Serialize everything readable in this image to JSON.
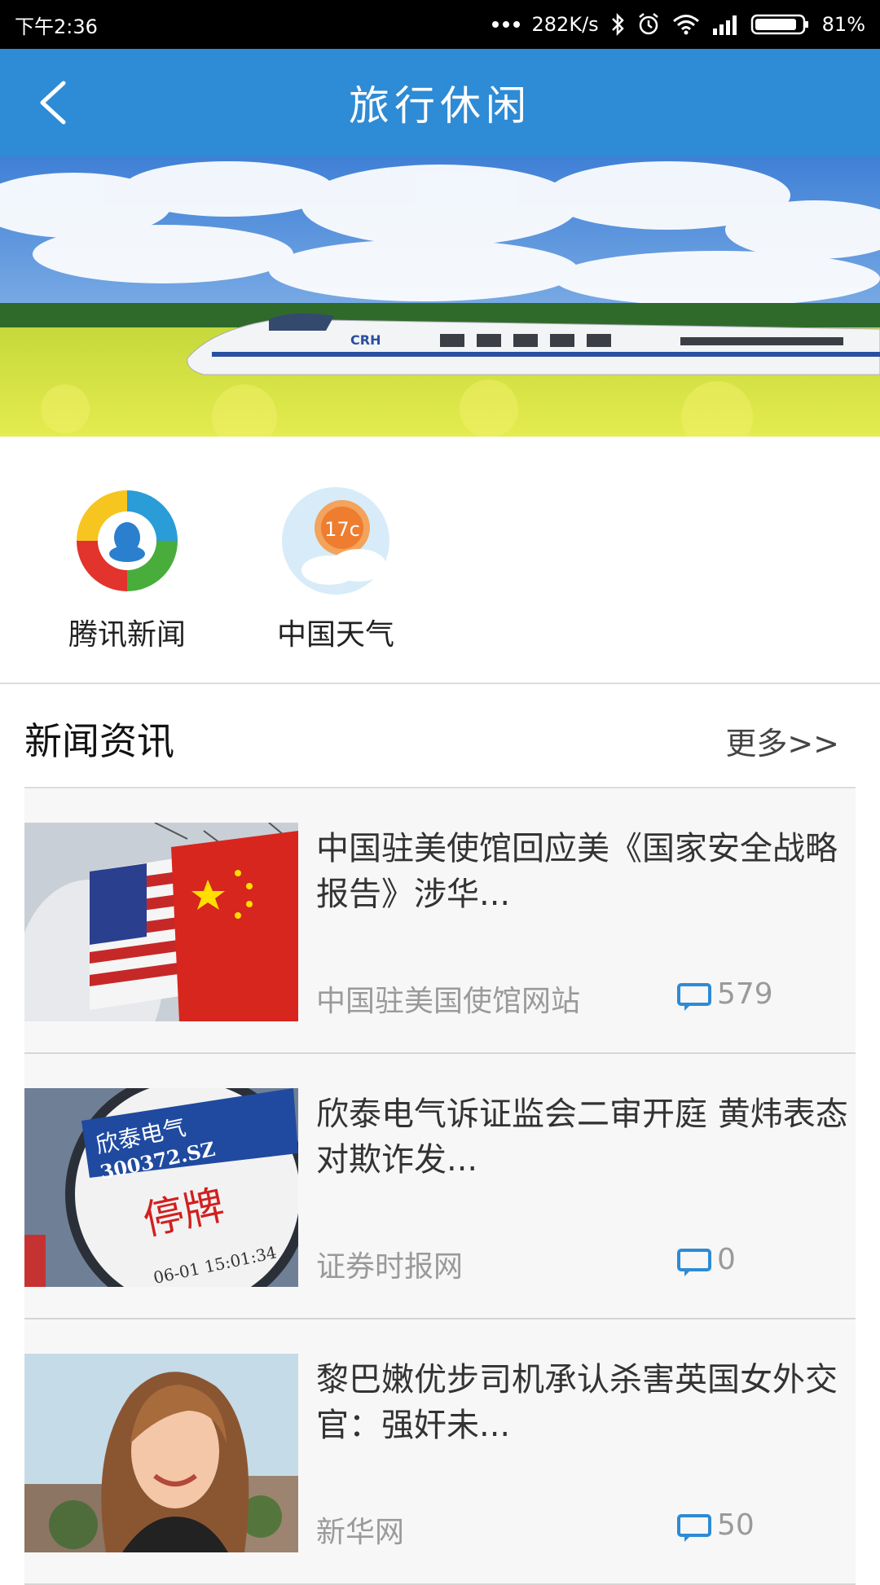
{
  "status_bar": {
    "time": "下午2:36",
    "network_speed": "282K/s",
    "battery": "81%"
  },
  "header": {
    "title": "旅行休闲",
    "back_icon": "chevron-left-icon"
  },
  "banner": {
    "train_label": "CRH"
  },
  "apps": [
    {
      "label": "腾讯新闻",
      "icon": "tencent-news-icon"
    },
    {
      "label": "中国天气",
      "icon": "china-weather-icon",
      "temp": "17c"
    }
  ],
  "news": {
    "section_title": "新闻资讯",
    "more_label": "更多>>",
    "items": [
      {
        "headline": "中国驻美使馆回应美《国家安全战略报告》涉华...",
        "source": "中国驻美国使馆网站",
        "comments": "579"
      },
      {
        "headline": "欣泰电气诉证监会二审开庭 黄炜表态对欺诈发...",
        "source": "证券时报网",
        "comments": "0"
      },
      {
        "headline": "黎巴嫩优步司机承认杀害英国女外交官：强奸未...",
        "source": "新华网",
        "comments": "50"
      }
    ]
  },
  "thumb_text": {
    "stock_name": "欣泰电气",
    "stock_code": "300372.SZ",
    "halt": "停牌",
    "time": "06-01 15:01:34"
  },
  "colors": {
    "header_blue": "#2e8bd5",
    "comment_icon": "#2e8bd5"
  }
}
